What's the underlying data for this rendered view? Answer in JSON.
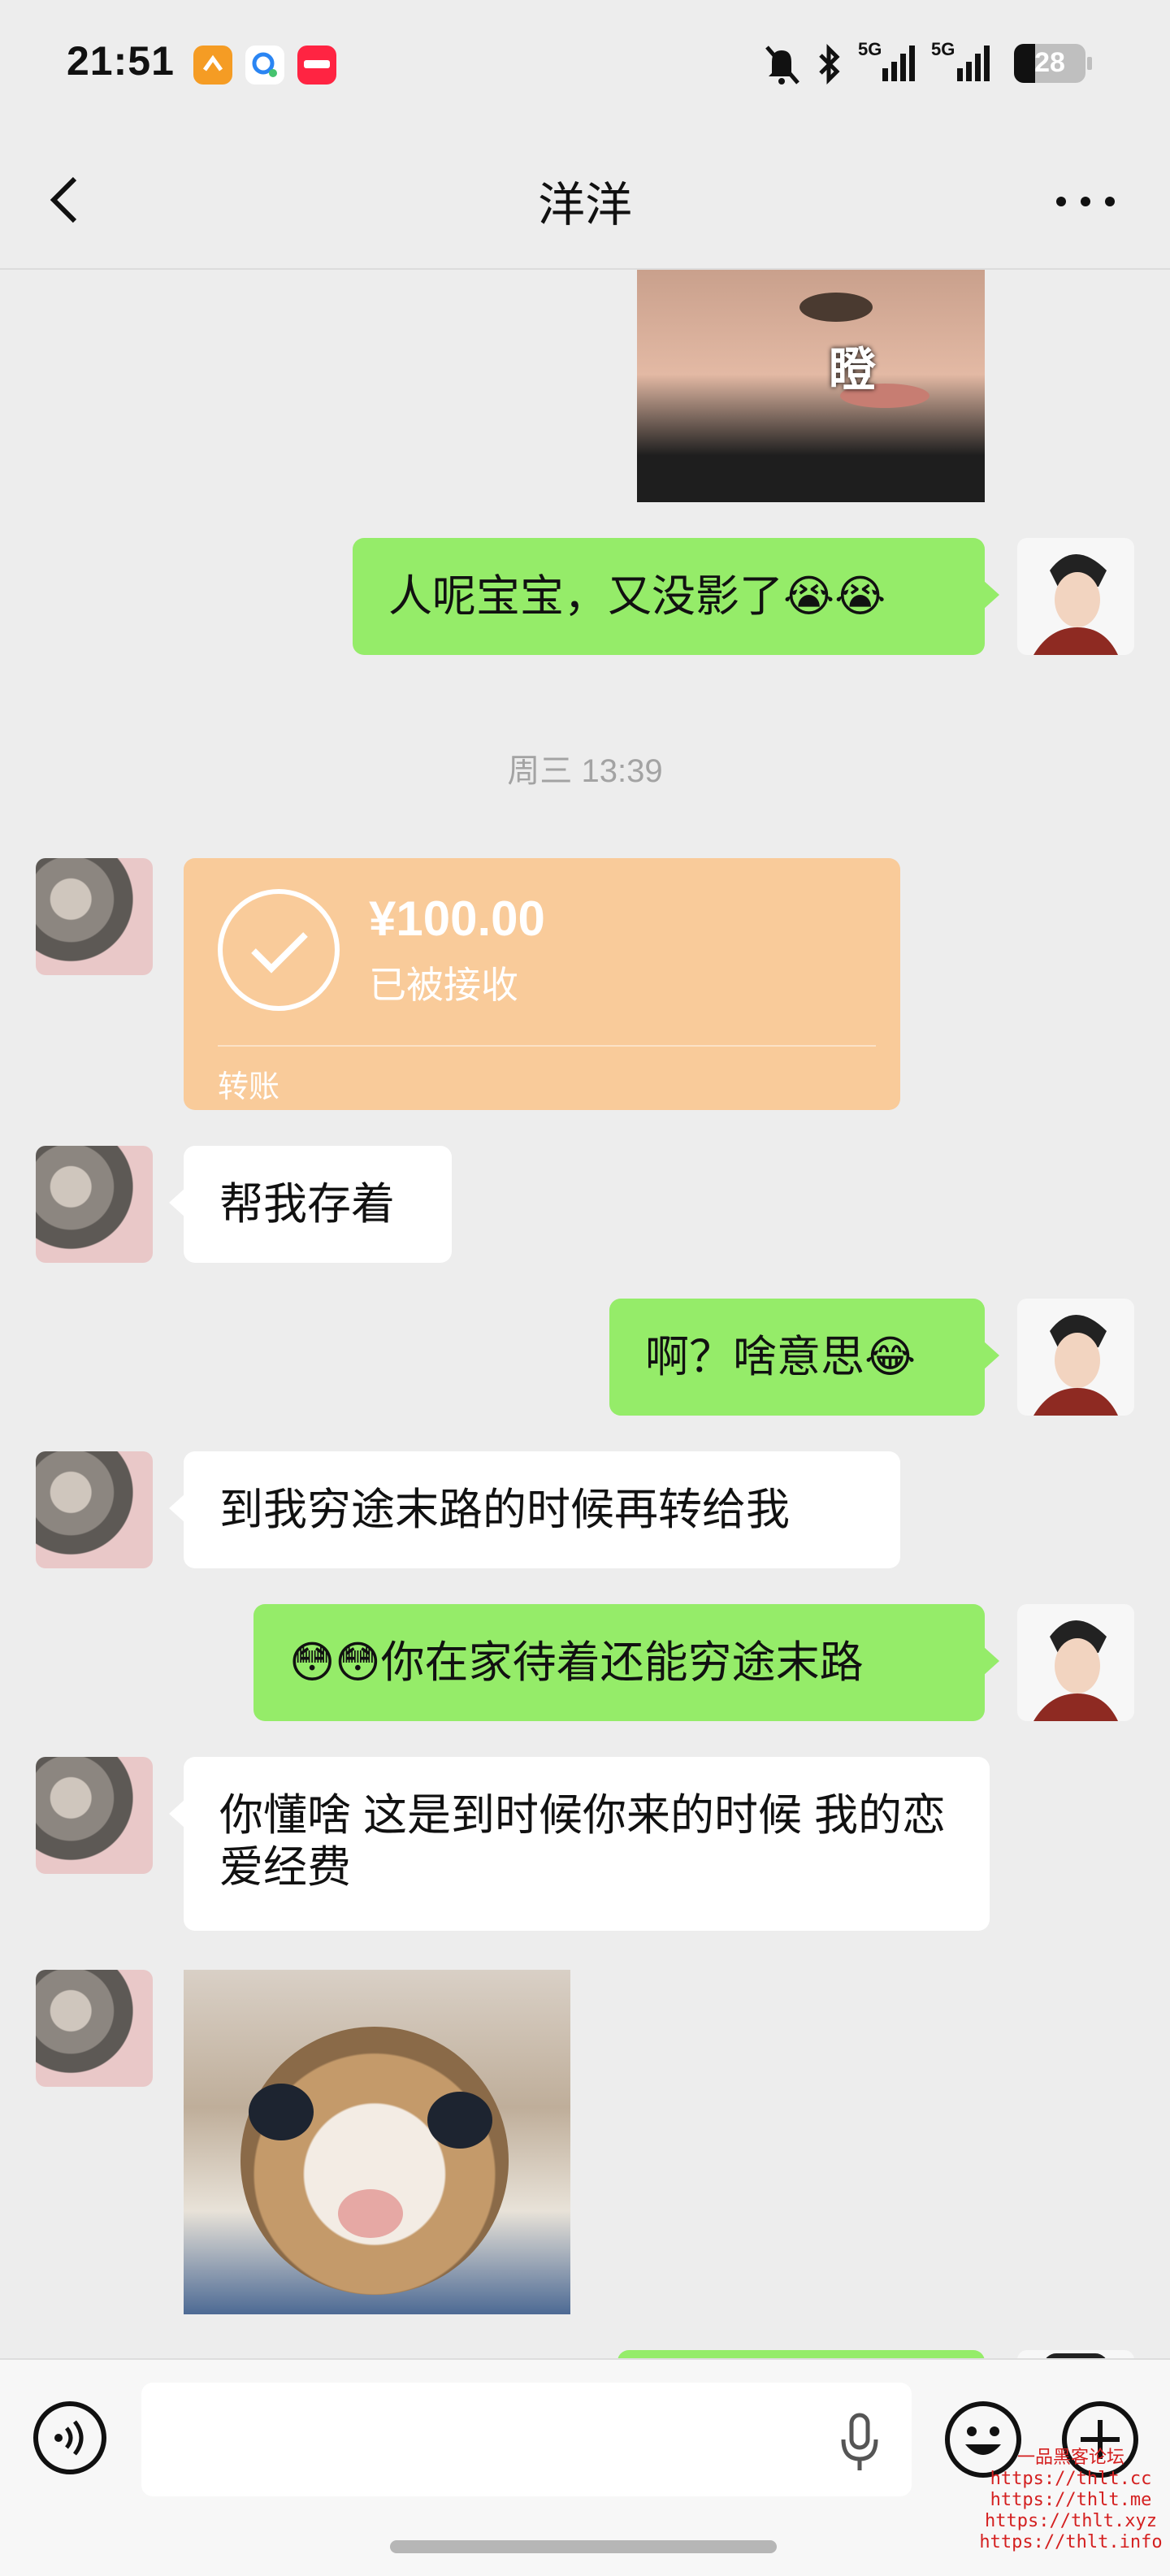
{
  "status_bar": {
    "time": "21:51",
    "signal_1_label": "5G",
    "signal_2_label": "5G",
    "battery": "28",
    "icons": [
      "bell-muted-icon",
      "bluetooth-icon",
      "signal-icon",
      "signal-icon",
      "battery-icon"
    ]
  },
  "nav": {
    "title": "洋洋",
    "back_icon": "chevron-left-icon",
    "more_icon": "more-icon"
  },
  "messages": {
    "sticker_top_text": "瞪",
    "msg1": "人呢宝宝，又没影了😭😭",
    "timestamp": "周三 13:39",
    "transfer": {
      "amount": "¥100.00",
      "status": "已被接收",
      "label": "转账"
    },
    "msg2": "帮我存着",
    "msg3": "啊？啥意思😂",
    "msg4": "到我穷途末路的时候再转给我",
    "msg5": "😳😳你在家待着还能穷途末路",
    "msg6": "你懂啥 这是到时候你来的时候 我的恋爱经费"
  },
  "input": {
    "voice_icon": "voice-icon",
    "mic_icon": "microphone-icon",
    "emoji_icon": "emoji-icon",
    "plus_icon": "plus-icon",
    "value": ""
  },
  "watermark": {
    "title": "一品黑客论坛",
    "lines": [
      "https://thlt.cc",
      "https://thlt.me",
      "https://thlt.xyz",
      "https://thlt.info"
    ]
  },
  "colors": {
    "background": "#ededed",
    "bubble_green": "#95ec69",
    "bubble_white": "#ffffff",
    "transfer": "#f9cb9a"
  }
}
